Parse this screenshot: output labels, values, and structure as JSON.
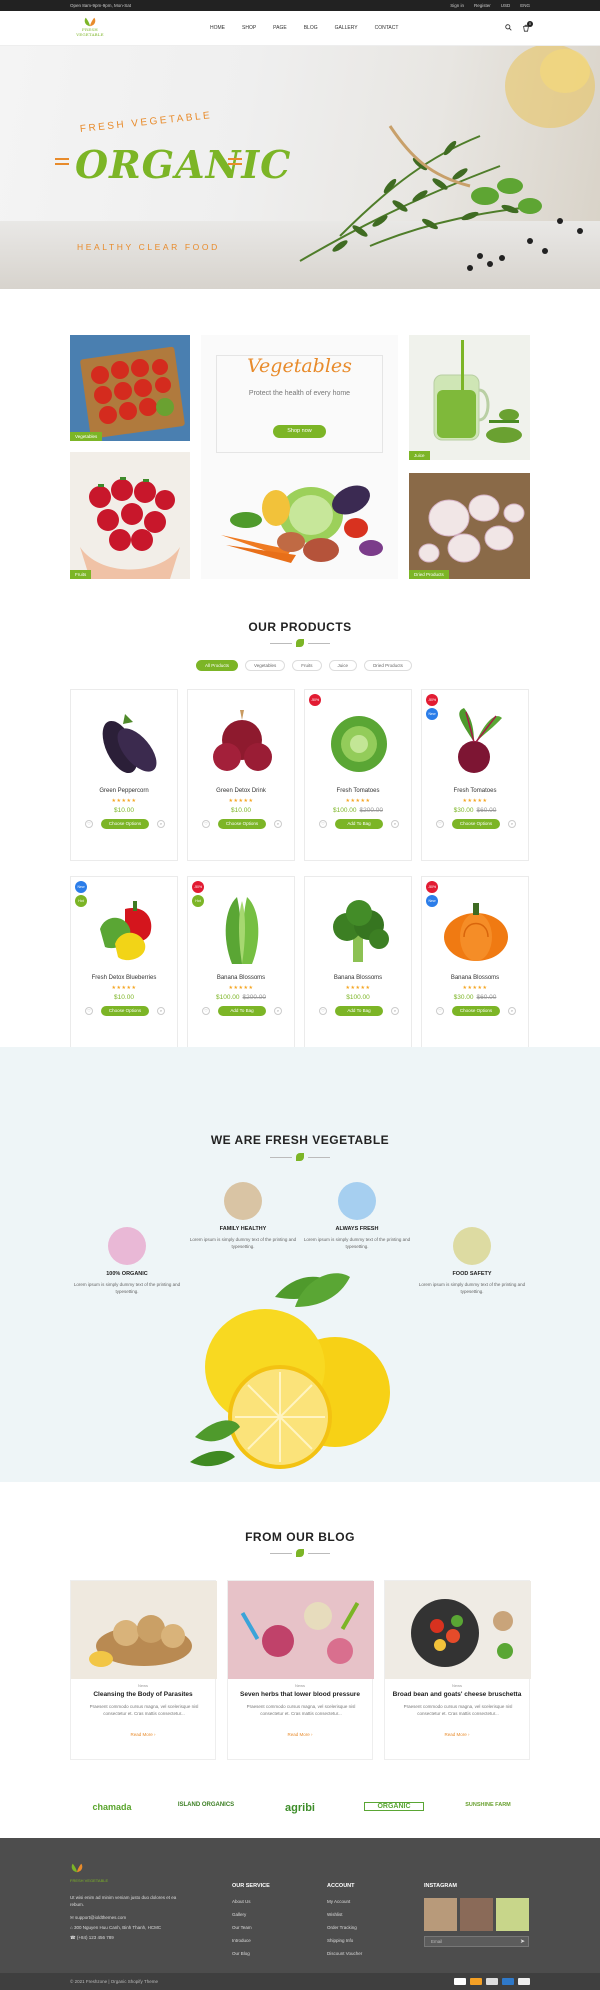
{
  "topbar": {
    "hours": "Open 8am-9pm-9pm, Mon-Sat",
    "signin": "Sign in",
    "register": "Register",
    "currency": "USD",
    "language": "ENG"
  },
  "header": {
    "logo_text": "FRESH VEGETABLE",
    "nav": [
      "HOME",
      "SHOP",
      "PAGE",
      "BLOG",
      "GALLERY",
      "CONTACT"
    ],
    "cart_count": "0"
  },
  "hero": {
    "line1": "FRESH VEGETABLE",
    "line2": "ORGANIC",
    "line3": "HEALTHY CLEAR FOOD"
  },
  "banners": {
    "vegetables": "Vegetables",
    "fruits": "Fruits",
    "juice": "Juice",
    "dried": "Dried Products",
    "center_title": "Vegetables",
    "center_sub": "Protect the health of every home",
    "center_btn": "Shop now"
  },
  "products": {
    "title": "OUR PRODUCTS",
    "filters": [
      "All Products",
      "Vegetables",
      "Fruits",
      "Juice",
      "Dried Products"
    ],
    "items": [
      {
        "name": "Green Peppercorn",
        "price": "$10.00",
        "old": "",
        "btn": "Choose Options",
        "badge": "",
        "badge2": ""
      },
      {
        "name": "Green Detox Drink",
        "price": "$10.00",
        "old": "",
        "btn": "Choose Options",
        "badge": "",
        "badge2": ""
      },
      {
        "name": "Fresh Tomatoes",
        "price": "$100.00",
        "old": "$200.00",
        "btn": "Add To Bag",
        "badge": "-50%",
        "badge2": ""
      },
      {
        "name": "Fresh Tomatoes",
        "price": "$30.00",
        "old": "$60.00",
        "btn": "Choose Options",
        "badge": "-50%",
        "badge2": "New"
      },
      {
        "name": "Fresh Detox Blueberries",
        "price": "$10.00",
        "old": "",
        "btn": "Choose Options",
        "badge": "New",
        "badge2": "Hot"
      },
      {
        "name": "Banana Blossoms",
        "price": "$100.00",
        "old": "$200.00",
        "btn": "Add To Bag",
        "badge": "-50%",
        "badge2": "Hot"
      },
      {
        "name": "Banana Blossoms",
        "price": "$100.00",
        "old": "",
        "btn": "Add To Bag",
        "badge": "",
        "badge2": ""
      },
      {
        "name": "Banana Blossoms",
        "price": "$30.00",
        "old": "$60.00",
        "btn": "Choose Options",
        "badge": "-50%",
        "badge2": "New"
      }
    ]
  },
  "fresh": {
    "title": "WE ARE FRESH VEGETABLE",
    "desc": "Lorem ipsum is simply dummy text of the printing and typesetting.",
    "f1": "FAMILY HEALTHY",
    "f2": "ALWAYS FRESH",
    "f3": "100% ORGANIC",
    "f4": "FOOD SAFETY"
  },
  "blog": {
    "title": "FROM OUR BLOG",
    "cat": "News",
    "more": "Read More",
    "desc": "Praesent commodo cursus magna, vel scelerisque nisl consectetur et. Cras mattis consectetur...",
    "posts": [
      "Cleansing the Body of Parasites",
      "Seven herbs that lower blood pressure",
      "Broad bean and goats' cheese bruschetta"
    ]
  },
  "brands": [
    "chamada",
    "ISLAND ORGANICS",
    "agribi",
    "ORGANIC",
    "SUNSHINE FARM"
  ],
  "footer": {
    "logo_text": "FRESH VEGETABLE",
    "about": "Ut wisi enim ad minim veniam justo duo dolores et ea rebum.",
    "email": "support@ioldthemes.com",
    "address": "300 Nguyen Huu Canh, Binh Thanh, HCMC",
    "phone": "(+84) 123 456 789",
    "service_title": "OUR SERVICE",
    "service": [
      "About Us",
      "Gallery",
      "Our Team",
      "Introduce",
      "Our Blog"
    ],
    "account_title": "ACCOUNT",
    "account": [
      "My Account",
      "Wishlist",
      "Order Tracking",
      "Shipping Info",
      "Discount Voucher"
    ],
    "instagram_title": "INSTAGRAM",
    "email_placeholder": "Email",
    "copyright": "© 2021 Freshzone | Organic Shopify Theme"
  },
  "colors": {
    "accent": "#7cb526",
    "orange": "#e88b2b",
    "fresh_bg": "#eef5f7",
    "footer_bg": "#4d4d4d"
  }
}
